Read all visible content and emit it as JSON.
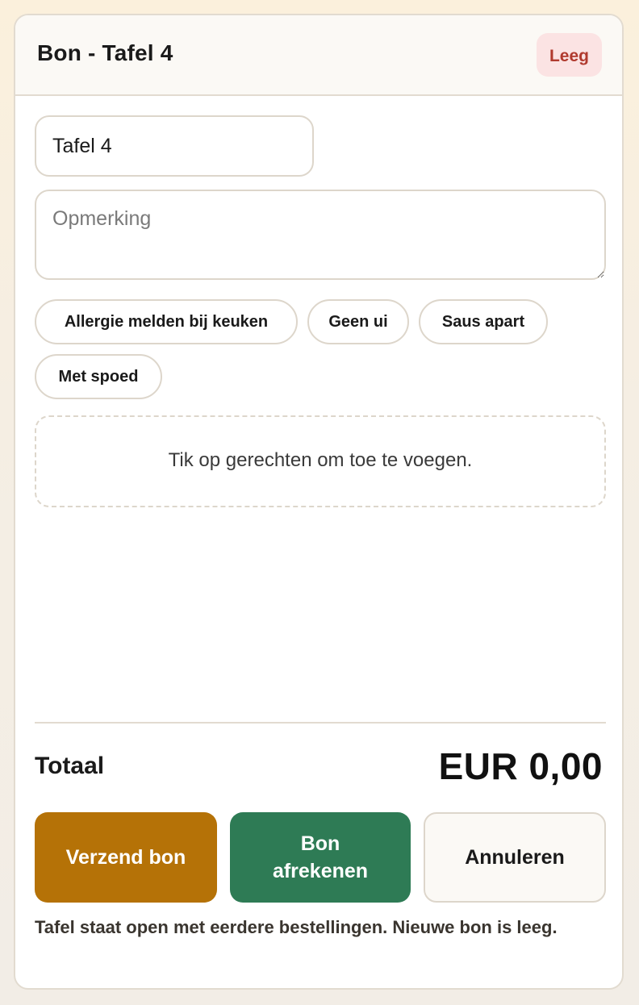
{
  "header": {
    "title": "Bon - Tafel 4",
    "status_badge": "Leeg"
  },
  "form": {
    "table_value": "Tafel 4",
    "note_placeholder": "Opmerking",
    "note_value": ""
  },
  "quick_notes": [
    {
      "label": "Allergie melden bij keuken"
    },
    {
      "label": "Geen ui"
    },
    {
      "label": "Saus apart"
    },
    {
      "label": "Met spoed"
    }
  ],
  "items": {
    "empty_message": "Tik op gerechten om toe te voegen."
  },
  "total": {
    "label": "Totaal",
    "value": "EUR 0,00"
  },
  "actions": {
    "send_label": "Verzend bon",
    "pay_label": "Bon afrekenen",
    "cancel_label": "Annuleren"
  },
  "footer": {
    "note": "Tafel staat open met eerdere bestellingen. Nieuwe bon is leeg."
  },
  "colors": {
    "send": "#b57207",
    "pay": "#2e7b55",
    "badge_bg": "#fbe3e3",
    "badge_text": "#b03a2e"
  }
}
